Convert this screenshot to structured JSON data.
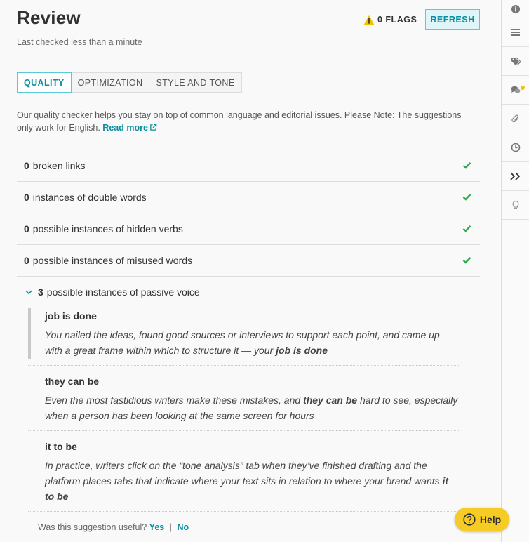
{
  "header": {
    "title": "Review",
    "last_checked": "Last checked less than a minute",
    "flags_label": "0 FLAGS",
    "refresh_label": "REFRESH"
  },
  "tabs": [
    {
      "label": "QUALITY",
      "active": true
    },
    {
      "label": "OPTIMIZATION",
      "active": false
    },
    {
      "label": "STYLE AND TONE",
      "active": false
    }
  ],
  "description": {
    "text": "Our quality checker helps you stay on top of common language and editorial issues. Please Note: The suggestions only work for English.",
    "read_more": "Read more"
  },
  "checks": [
    {
      "count": "0",
      "label": "broken links"
    },
    {
      "count": "0",
      "label": "instances of double words"
    },
    {
      "count": "0",
      "label": "possible instances of hidden verbs"
    },
    {
      "count": "0",
      "label": "possible instances of misused words"
    }
  ],
  "passive": {
    "count": "3",
    "label": "possible instances of passive voice",
    "suggestions": [
      {
        "phrase": "job is done",
        "before": "You nailed the ideas, found good sources or interviews to support each point, and came up with a great frame within which to structure it — your ",
        "match": "job is done",
        "after": ""
      },
      {
        "phrase": "they can be",
        "before": "Even the most fastidious writers make these mistakes, and ",
        "match": "they can be",
        "after": " hard to see, especially when a person has been looking at the same screen for hours"
      },
      {
        "phrase": "it to be",
        "before": "In practice, writers click on the “tone analysis” tab when they’ve finished drafting and the platform places tabs that indicate where your text sits in relation to where your brand wants ",
        "match": "it to be",
        "after": ""
      }
    ]
  },
  "feedback": {
    "question": "Was this suggestion useful?",
    "yes": "Yes",
    "separator": "|",
    "no": "No"
  },
  "help_label": "Help",
  "rail_icons": [
    "info-icon",
    "list-icon",
    "tags-icon",
    "comments-icon",
    "attachment-icon",
    "history-icon",
    "expand-icon",
    "lightbulb-icon"
  ],
  "colors": {
    "accent": "#0b8fa0",
    "check_green": "#2eaa4e",
    "warning": "#f2c400",
    "help_bg": "#f6cb25"
  }
}
